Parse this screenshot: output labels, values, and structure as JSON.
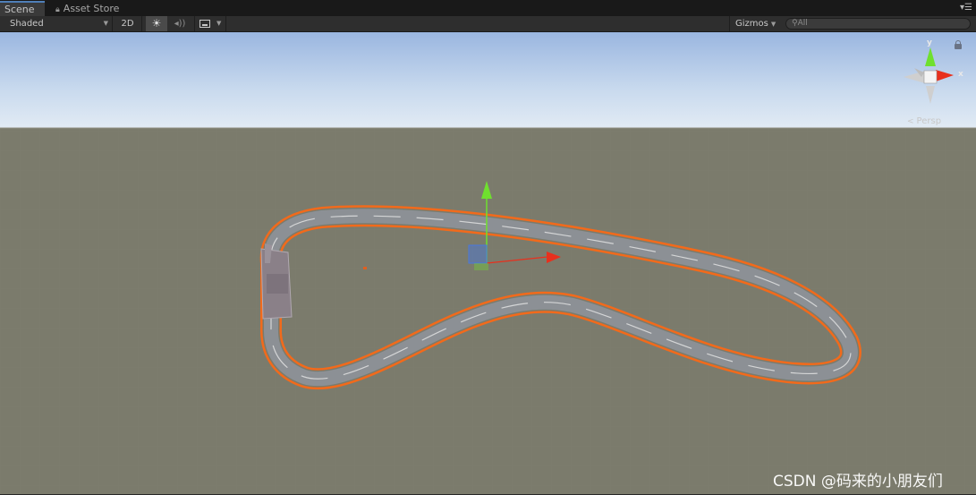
{
  "tabs": {
    "scene": "Scene",
    "asset_store": "Asset Store"
  },
  "toolbar": {
    "shading_mode": "Shaded",
    "mode_2d": "2D",
    "lighting_icon": "sun-icon",
    "audio_icon": "speaker-icon",
    "effects_icon": "image-icon",
    "gizmos": "Gizmos",
    "search_value": "All"
  },
  "view": {
    "projection": "Persp",
    "axis_y": "y",
    "axis_x": "x"
  },
  "colors": {
    "sky_top": "#a6bfe5",
    "sky_horizon": "#dde8f3",
    "ground": "#7b7b6c",
    "selection_outline": "#f26a1b",
    "gizmo_x": "#e8301d",
    "gizmo_y": "#6fe02e",
    "gizmo_z": "#4878e0"
  },
  "watermark": "CSDN @码来的小朋友们"
}
